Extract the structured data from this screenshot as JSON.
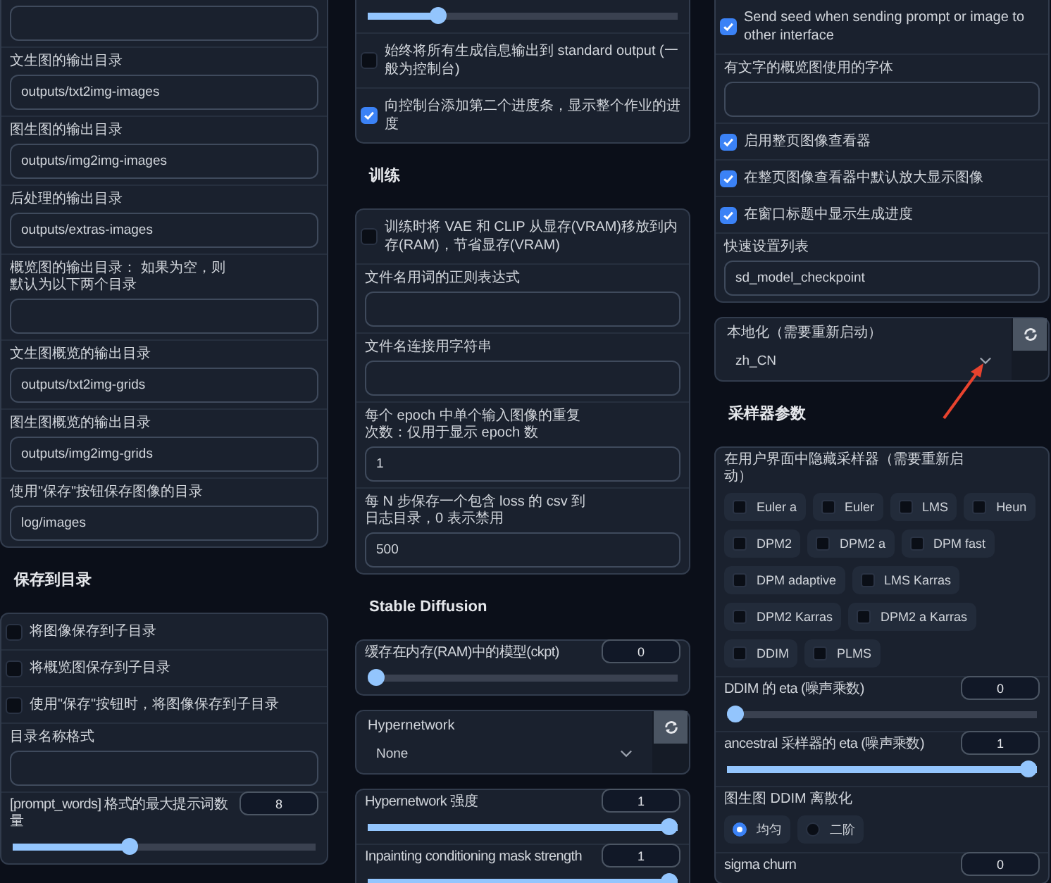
{
  "columns": [
    {
      "blocks": [
        {
          "kind": "panel",
          "items": [
            {
              "kind": "text"
            },
            {
              "kind": "text",
              "label": "文生图的输出目录",
              "value": "outputs/txt2img-images"
            },
            {
              "kind": "text",
              "label": "图生图的输出目录",
              "value": "outputs/img2img-images"
            },
            {
              "kind": "text",
              "label": "后处理的输出目录",
              "value": "outputs/extras-images"
            },
            {
              "kind": "text",
              "label": "概览图的输出目录： 如果为空，则默认为以下两个目录"
            },
            {
              "kind": "text",
              "label": "文生图概览的输出目录",
              "value": "outputs/txt2img-grids"
            },
            {
              "kind": "text",
              "label": "图生图概览的输出目录",
              "value": "outputs/img2img-grids"
            },
            {
              "kind": "text",
              "label": "使用\"保存\"按钮保存图像的目录",
              "value": "log/images"
            }
          ]
        },
        {
          "kind": "heading",
          "text": "保存到目录"
        },
        {
          "kind": "panel",
          "items": [
            {
              "kind": "checkbox",
              "label": "将图像保存到子目录",
              "checked": false
            },
            {
              "kind": "checkbox",
              "label": "将概览图保存到子目录",
              "checked": false
            },
            {
              "kind": "checkbox",
              "label": "使用\"保存\"按钮时，将图像保存到子目录",
              "checked": false
            },
            {
              "kind": "text",
              "label": "目录名称格式"
            },
            {
              "kind": "slider",
              "label": "[prompt_words] 格式的最大提示词数量",
              "value": "8",
              "level": 0.38
            }
          ]
        }
      ]
    },
    {
      "blocks": [
        {
          "kind": "panel",
          "items": [
            {
              "kind": "slider",
              "level": 0.21
            },
            {
              "kind": "checkbox",
              "label": "始终将所有生成信息输出到 standard output (一般为控制台)",
              "checked": false
            },
            {
              "kind": "checkbox",
              "label": "向控制台添加第二个进度条，显示整个作业的进度",
              "checked": true
            }
          ]
        },
        {
          "kind": "heading",
          "text": "训练"
        },
        {
          "kind": "panel",
          "items": [
            {
              "kind": "checkbox",
              "label": "训练时将 VAE 和 CLIP 从显存(VRAM)移放到内存(RAM)，节省显存(VRAM)",
              "checked": false
            },
            {
              "kind": "text",
              "label": "文件名用词的正则表达式"
            },
            {
              "kind": "text",
              "label": "文件名连接用字符串"
            },
            {
              "kind": "text",
              "label": "每个 epoch 中单个输入图像的重复次数：仅用于显示 epoch 数",
              "value": "1"
            },
            {
              "kind": "text",
              "label": "每 N 步保存一个包含 loss 的 csv 到日志目录，0 表示禁用",
              "value": "500"
            }
          ]
        },
        {
          "kind": "heading",
          "text": "Stable Diffusion"
        },
        {
          "kind": "panel",
          "items": [
            {
              "kind": "slider",
              "label": "缓存在内存(RAM)中的模型(ckpt)",
              "value": "0",
              "level": 0
            }
          ]
        },
        {
          "kind": "panel",
          "items": [
            {
              "kind": "dropdown",
              "label": "Hypernetwork",
              "value": "None"
            }
          ]
        },
        {
          "kind": "panel",
          "items": [
            {
              "kind": "slider",
              "label": "Hypernetwork 强度",
              "value": "1",
              "level": 1
            },
            {
              "kind": "slider",
              "label": "Inpainting conditioning mask strength",
              "value": "1",
              "level": 1
            }
          ]
        }
      ]
    },
    {
      "blocks": [
        {
          "kind": "panel",
          "items": [
            {
              "kind": "checkbox",
              "label": "Send seed when sending prompt or image to other interface",
              "checked": true
            },
            {
              "kind": "text",
              "label": "有文字的概览图使用的字体"
            },
            {
              "kind": "checkbox",
              "label": "启用整页图像查看器",
              "checked": true
            },
            {
              "kind": "checkbox",
              "label": "在整页图像查看器中默认放大显示图像",
              "checked": true
            },
            {
              "kind": "checkbox",
              "label": "在窗口标题中显示生成进度",
              "checked": true
            },
            {
              "kind": "text",
              "label": "快速设置列表",
              "value": "sd_model_checkpoint"
            }
          ]
        },
        {
          "kind": "panel",
          "items": [
            {
              "kind": "dropdown",
              "label": "本地化（需要重新启动）",
              "value": "zh_CN"
            }
          ]
        },
        {
          "kind": "heading",
          "text": "采样器参数"
        },
        {
          "kind": "panel",
          "items": [
            {
              "kind": "chips",
              "label": "在用户界面中隐藏采样器（需要重新启动）",
              "options": [
                {
                  "label": "Euler a",
                  "checked": false
                },
                {
                  "label": "Euler",
                  "checked": false
                },
                {
                  "label": "LMS",
                  "checked": false
                },
                {
                  "label": "Heun",
                  "checked": false
                },
                {
                  "label": "DPM2",
                  "checked": false
                },
                {
                  "label": "DPM2 a",
                  "checked": false
                },
                {
                  "label": "DPM fast",
                  "checked": false
                },
                {
                  "label": "DPM adaptive",
                  "checked": false
                },
                {
                  "label": "LMS Karras",
                  "checked": false
                },
                {
                  "label": "DPM2 Karras",
                  "checked": false
                },
                {
                  "label": "DPM2 a Karras",
                  "checked": false
                },
                {
                  "label": "DDIM",
                  "checked": false
                },
                {
                  "label": "PLMS",
                  "checked": false
                }
              ]
            },
            {
              "kind": "slider",
              "label": "DDIM 的 eta (噪声乘数)",
              "value": "0",
              "level": 0
            },
            {
              "kind": "slider",
              "label": "ancestral 采样器的 eta (噪声乘数)",
              "value": "1",
              "level": 1
            },
            {
              "kind": "radio",
              "label": "图生图 DDIM 离散化",
              "options": [
                {
                  "label": "均匀",
                  "selected": true
                },
                {
                  "label": "二阶",
                  "selected": false
                }
              ]
            },
            {
              "kind": "slider",
              "label": "sigma churn",
              "value": "0"
            }
          ]
        }
      ]
    }
  ]
}
